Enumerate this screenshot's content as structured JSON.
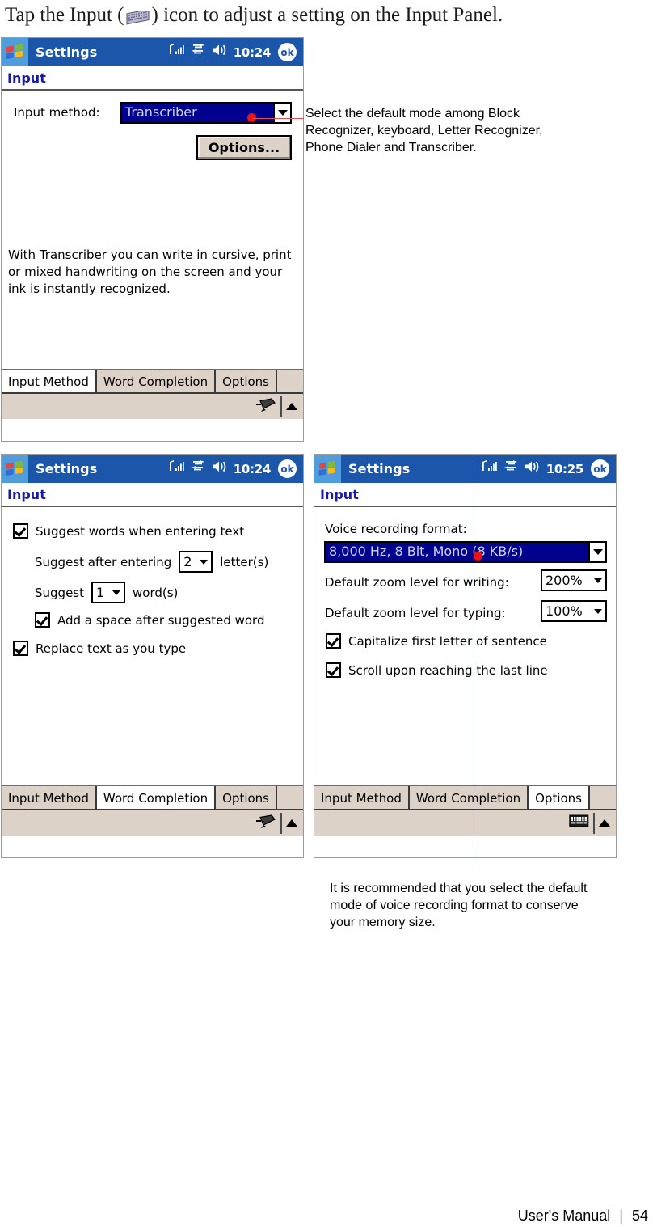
{
  "intro": {
    "before": "Tap the Input (",
    "icon": "keyboard-icon",
    "after": ") icon to adjust a setting on the Input Panel."
  },
  "panels": [
    {
      "id": "input-method",
      "titlebar": {
        "app_title": "Settings",
        "clock": "10:24",
        "ok_label": "ok",
        "icons": [
          "windows-logo-icon",
          "signal-strength-icon",
          "connectivity-icon",
          "speaker-icon",
          "ok-button"
        ]
      },
      "page_title": "Input",
      "input_method_label": "Input method:",
      "input_method_value": "Transcriber",
      "options_button": "Options...",
      "description": "With Transcriber you can write in cursive, print or mixed handwriting on the screen and your ink is instantly recognized.",
      "tabs": [
        {
          "label": "Input Method",
          "active": true
        },
        {
          "label": "Word Completion",
          "active": false
        },
        {
          "label": "Options",
          "active": false
        }
      ],
      "soft_icon": "pen-input-icon"
    },
    {
      "id": "word-completion",
      "titlebar": {
        "app_title": "Settings",
        "clock": "10:24",
        "ok_label": "ok"
      },
      "page_title": "Input",
      "checkboxes": [
        {
          "label": "Suggest words when entering text",
          "checked": true
        },
        {
          "label": "Add a space after suggested word",
          "checked": true
        },
        {
          "label": "Replace text as you type",
          "checked": true
        }
      ],
      "suggest_after_prefix": "Suggest after entering",
      "suggest_after_value": "2",
      "suggest_after_suffix": "letter(s)",
      "suggest_words_prefix": "Suggest",
      "suggest_words_value": "1",
      "suggest_words_suffix": "word(s)",
      "tabs": [
        {
          "label": "Input Method",
          "active": false
        },
        {
          "label": "Word Completion",
          "active": true
        },
        {
          "label": "Options",
          "active": false
        }
      ],
      "soft_icon": "pen-input-icon"
    },
    {
      "id": "options",
      "titlebar": {
        "app_title": "Settings",
        "clock": "10:25",
        "ok_label": "ok"
      },
      "page_title": "Input",
      "voice_format_label": "Voice recording format:",
      "voice_format_value": "8,000 Hz, 8 Bit, Mono (8 KB/s)",
      "zoom_writing_label": "Default zoom level for writing:",
      "zoom_writing_value": "200%",
      "zoom_typing_label": "Default zoom level for typing:",
      "zoom_typing_value": "100%",
      "checkboxes": [
        {
          "label": "Capitalize first letter of sentence",
          "checked": true
        },
        {
          "label": "Scroll upon reaching the last line",
          "checked": true
        }
      ],
      "tabs": [
        {
          "label": "Input Method",
          "active": false
        },
        {
          "label": "Word Completion",
          "active": false
        },
        {
          "label": "Options",
          "active": true
        }
      ],
      "soft_icon": "keyboard-input-icon"
    }
  ],
  "annotations": [
    {
      "id": "input-method-note",
      "text": "Select the default mode among Block Recognizer, keyboard, Letter Recognizer, Phone Dialer and Transcriber.",
      "color": "#e45050"
    },
    {
      "id": "voice-format-note",
      "text": "It is recommended that you select the default mode of voice recording format to conserve your memory size.",
      "color": "#e45050"
    }
  ],
  "footer": {
    "manual_label": "User's Manual",
    "separator": "|",
    "page_number": "54"
  }
}
